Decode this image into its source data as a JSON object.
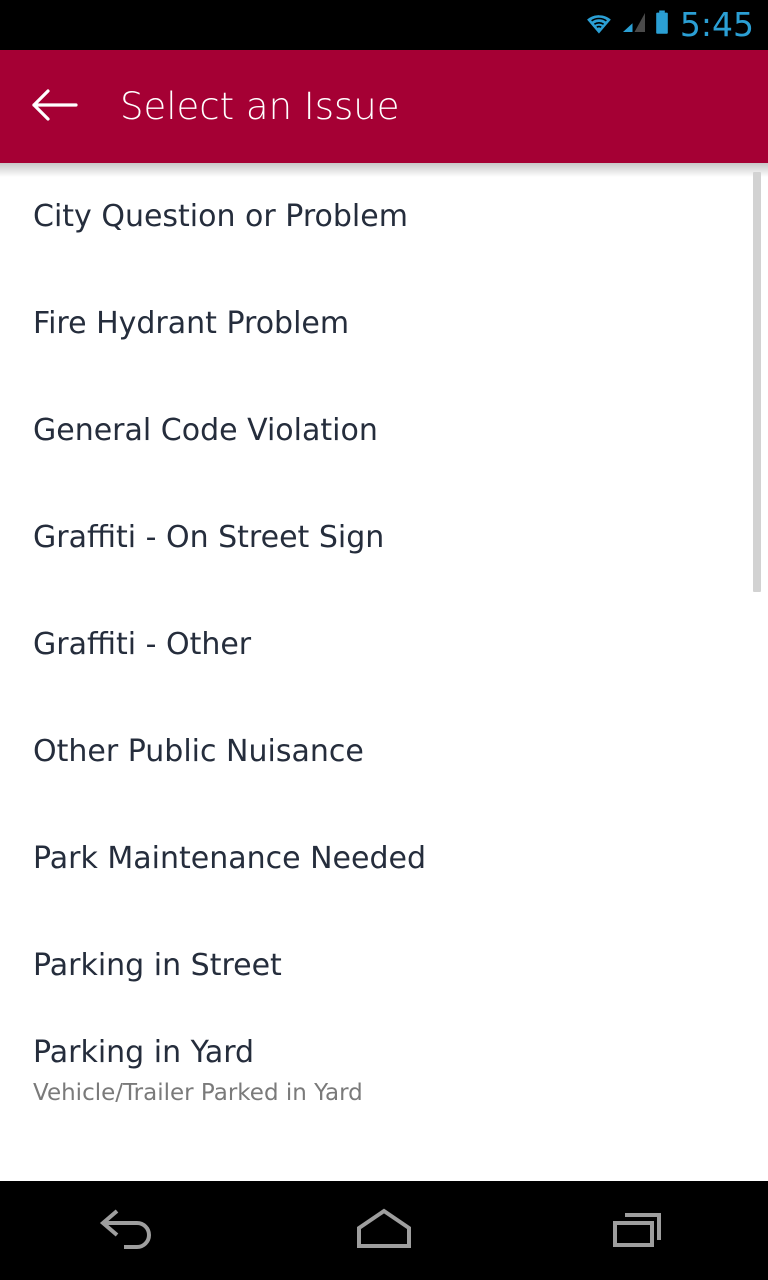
{
  "status_bar": {
    "clock": "5:45",
    "icons": [
      {
        "name": "wifi-icon",
        "label": "wifi"
      },
      {
        "name": "cellular-signal-icon",
        "label": "signal"
      },
      {
        "name": "battery-icon",
        "label": "battery"
      }
    ],
    "background_color": "#000000",
    "icon_color": "#2b9fd4"
  },
  "app_bar": {
    "title": "Select an Issue",
    "back_icon": "arrow-left-icon",
    "background_color": "#a50034",
    "text_color": "#ffffff"
  },
  "list": {
    "items": [
      {
        "title": "City Question or Problem",
        "subtitle": ""
      },
      {
        "title": "Fire Hydrant Problem",
        "subtitle": ""
      },
      {
        "title": "General Code Violation",
        "subtitle": ""
      },
      {
        "title": "Graffiti - On Street Sign",
        "subtitle": ""
      },
      {
        "title": "Graffiti - Other",
        "subtitle": ""
      },
      {
        "title": "Other Public Nuisance",
        "subtitle": ""
      },
      {
        "title": "Park Maintenance Needed",
        "subtitle": ""
      },
      {
        "title": "Parking in Street",
        "subtitle": ""
      },
      {
        "title": "Parking in Yard",
        "subtitle": "Vehicle/Trailer Parked in Yard"
      }
    ],
    "title_color": "#252d3c",
    "subtitle_color": "#7a7a7a",
    "scrollbar_color": "#d2d2d2"
  },
  "nav_bar": {
    "buttons": [
      {
        "name": "nav-back-icon",
        "label": "Back"
      },
      {
        "name": "nav-home-icon",
        "label": "Home"
      },
      {
        "name": "nav-recents-icon",
        "label": "Recents"
      }
    ],
    "background_color": "#000000",
    "icon_color": "#9e9e9e"
  }
}
